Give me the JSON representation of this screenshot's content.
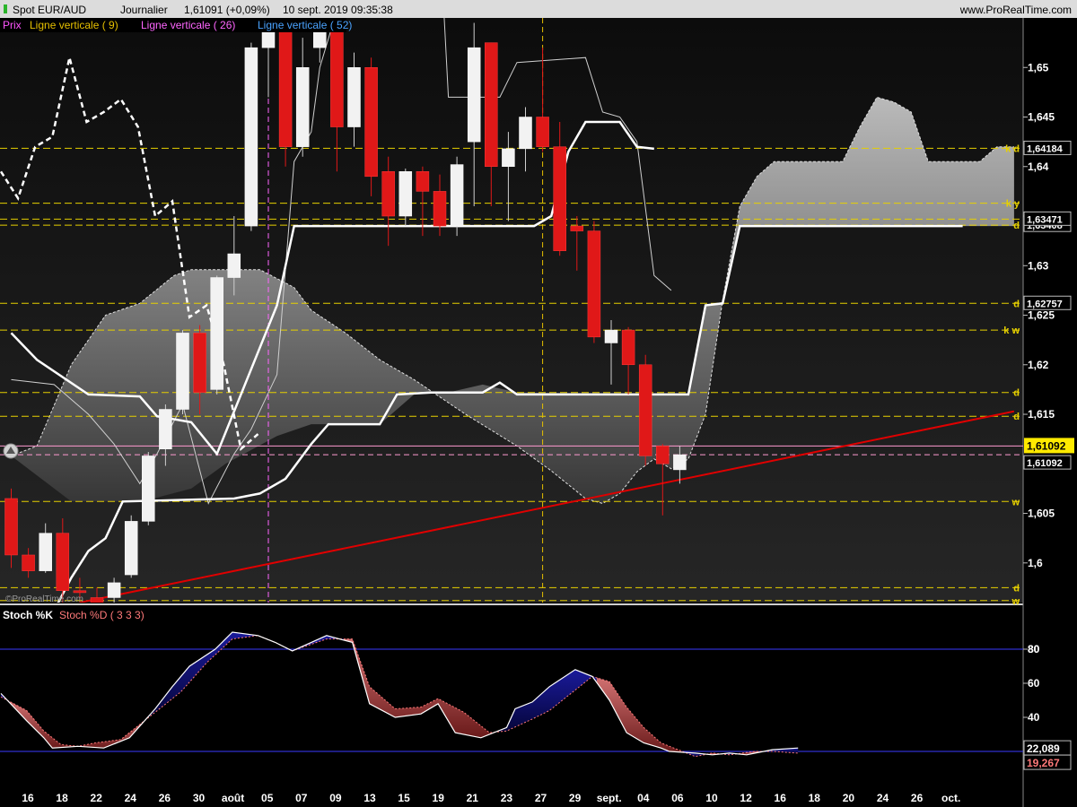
{
  "header": {
    "instrument": "Spot EUR/AUD",
    "period": "Journalier",
    "quote": "1,61091 (+0,09%)",
    "timestamp": "10 sept. 2019 09:35:38",
    "site": "www.ProRealTime.com"
  },
  "legend_main": [
    {
      "label": "Prix",
      "color": "#ff55ff"
    },
    {
      "label": "Ligne verticale ( 9)",
      "color": "#e6c000"
    },
    {
      "label": "Ligne verticale ( 26)",
      "color": "#ff66ff"
    },
    {
      "label": "Ligne verticale ( 52)",
      "color": "#4aa3ff"
    }
  ],
  "legend_stoch": [
    {
      "label": "Stoch %K",
      "color": "#ffffff"
    },
    {
      "label": "Stoch %D ( 3 3 3)",
      "color": "#ff7a7a"
    }
  ],
  "watermark": "©ProRealTime.com",
  "colors": {
    "bull": "#f2f2f2",
    "bear": "#e01818",
    "guide": "#e6d000",
    "trendline": "#e00000",
    "cloud": "#9a9a9a",
    "vline_pink": "#ff66ff",
    "vline_yellow": "#e6c000",
    "stoch_up_fill": "#0a0a6e",
    "stoch_down_fill": "#c06060"
  },
  "chart_data": [
    {
      "type": "candlestick",
      "title": "Spot EUR/AUD Journalier",
      "ylim": [
        1.596,
        1.655
      ],
      "y_ticks": [
        "1,6",
        "1,605",
        "1,61",
        "1,615",
        "1,62",
        "1,625",
        "1,63",
        "1,635",
        "1,64",
        "1,645",
        "1,65"
      ],
      "x_ticks": [
        "16",
        "18",
        "22",
        "24",
        "26",
        "30",
        "août",
        "05",
        "07",
        "09",
        "13",
        "15",
        "19",
        "21",
        "23",
        "27",
        "29",
        "sept.",
        "04",
        "06",
        "10",
        "12",
        "16",
        "18",
        "20",
        "24",
        "26",
        "oct."
      ],
      "candles": [
        {
          "o": 1.6065,
          "h": 1.6075,
          "l": 1.5995,
          "c": 1.6008
        },
        {
          "o": 1.6008,
          "h": 1.6015,
          "l": 1.5985,
          "c": 1.5992
        },
        {
          "o": 1.5992,
          "h": 1.604,
          "l": 1.599,
          "c": 1.603
        },
        {
          "o": 1.603,
          "h": 1.6045,
          "l": 1.596,
          "c": 1.5972
        },
        {
          "o": 1.5972,
          "h": 1.5985,
          "l": 1.596,
          "c": 1.597
        },
        {
          "o": 1.5965,
          "h": 1.5975,
          "l": 1.594,
          "c": 1.595
        },
        {
          "o": 1.5965,
          "h": 1.5985,
          "l": 1.595,
          "c": 1.598
        },
        {
          "o": 1.5988,
          "h": 1.6048,
          "l": 1.5985,
          "c": 1.6042
        },
        {
          "o": 1.6042,
          "h": 1.6112,
          "l": 1.6038,
          "c": 1.6108
        },
        {
          "o": 1.6115,
          "h": 1.616,
          "l": 1.6098,
          "c": 1.6155
        },
        {
          "o": 1.6155,
          "h": 1.6235,
          "l": 1.615,
          "c": 1.6232
        },
        {
          "o": 1.6232,
          "h": 1.624,
          "l": 1.615,
          "c": 1.6172
        },
        {
          "o": 1.6175,
          "h": 1.629,
          "l": 1.617,
          "c": 1.6288
        },
        {
          "o": 1.6288,
          "h": 1.635,
          "l": 1.627,
          "c": 1.6312
        },
        {
          "o": 1.634,
          "h": 1.6525,
          "l": 1.6335,
          "c": 1.652
        },
        {
          "o": 1.652,
          "h": 1.657,
          "l": 1.647,
          "c": 1.6555
        },
        {
          "o": 1.656,
          "h": 1.6605,
          "l": 1.64,
          "c": 1.642
        },
        {
          "o": 1.642,
          "h": 1.653,
          "l": 1.641,
          "c": 1.65
        },
        {
          "o": 1.652,
          "h": 1.657,
          "l": 1.6505,
          "c": 1.6555
        },
        {
          "o": 1.66,
          "h": 1.662,
          "l": 1.6395,
          "c": 1.644
        },
        {
          "o": 1.644,
          "h": 1.6515,
          "l": 1.642,
          "c": 1.65
        },
        {
          "o": 1.65,
          "h": 1.651,
          "l": 1.637,
          "c": 1.639
        },
        {
          "o": 1.6395,
          "h": 1.641,
          "l": 1.632,
          "c": 1.635
        },
        {
          "o": 1.635,
          "h": 1.6398,
          "l": 1.634,
          "c": 1.6395
        },
        {
          "o": 1.6395,
          "h": 1.64,
          "l": 1.633,
          "c": 1.6375
        },
        {
          "o": 1.6375,
          "h": 1.6392,
          "l": 1.633,
          "c": 1.634
        },
        {
          "o": 1.634,
          "h": 1.641,
          "l": 1.633,
          "c": 1.6402
        },
        {
          "o": 1.6425,
          "h": 1.6545,
          "l": 1.636,
          "c": 1.652
        },
        {
          "o": 1.6525,
          "h": 1.6525,
          "l": 1.636,
          "c": 1.64
        },
        {
          "o": 1.64,
          "h": 1.6435,
          "l": 1.6345,
          "c": 1.6418
        },
        {
          "o": 1.6418,
          "h": 1.646,
          "l": 1.6395,
          "c": 1.645
        },
        {
          "o": 1.645,
          "h": 1.652,
          "l": 1.6415,
          "c": 1.642
        },
        {
          "o": 1.642,
          "h": 1.6445,
          "l": 1.631,
          "c": 1.6315
        },
        {
          "o": 1.634,
          "h": 1.635,
          "l": 1.6295,
          "c": 1.6335
        },
        {
          "o": 1.6335,
          "h": 1.6345,
          "l": 1.6222,
          "c": 1.6228
        },
        {
          "o": 1.6222,
          "h": 1.6245,
          "l": 1.618,
          "c": 1.6235
        },
        {
          "o": 1.6235,
          "h": 1.6238,
          "l": 1.617,
          "c": 1.62
        },
        {
          "o": 1.62,
          "h": 1.621,
          "l": 1.6098,
          "c": 1.6108
        },
        {
          "o": 1.6118,
          "h": 1.612,
          "l": 1.6048,
          "c": 1.61
        },
        {
          "o": 1.6094,
          "h": 1.6118,
          "l": 1.608,
          "c": 1.61092
        }
      ],
      "tenkan_dotted": [
        1.6395,
        1.6368,
        1.642,
        1.643,
        1.651,
        1.6445,
        1.6455,
        1.6468,
        1.644,
        1.635,
        1.6365,
        1.6248,
        1.626,
        1.62,
        1.6115,
        1.613
      ],
      "kijun": [
        [
          0,
          1.6232
        ],
        [
          1.5,
          1.6205
        ],
        [
          4.5,
          1.617
        ],
        [
          7.5,
          1.6168
        ],
        [
          8.5,
          1.6148
        ],
        [
          10.5,
          1.6142
        ],
        [
          12,
          1.611
        ],
        [
          15.5,
          1.626
        ],
        [
          16.5,
          1.634
        ],
        [
          30.5,
          1.634
        ],
        [
          31.5,
          1.635
        ],
        [
          32.5,
          1.6415
        ],
        [
          33.5,
          1.6445
        ],
        [
          35.5,
          1.6445
        ],
        [
          36.5,
          1.642
        ],
        [
          37.5,
          1.6418
        ]
      ],
      "kijun_projection": [
        [
          0,
          1.5948
        ],
        [
          2.5,
          1.5952
        ],
        [
          3.5,
          1.5985
        ],
        [
          4.5,
          1.6012
        ],
        [
          5.5,
          1.6025
        ],
        [
          6.5,
          1.6062
        ],
        [
          13,
          1.6065
        ],
        [
          14.5,
          1.607
        ],
        [
          16,
          1.6085
        ],
        [
          17.5,
          1.612
        ],
        [
          18.5,
          1.614
        ],
        [
          21.5,
          1.614
        ],
        [
          22.5,
          1.617
        ],
        [
          24.5,
          1.6172
        ],
        [
          27.5,
          1.6172
        ],
        [
          28.5,
          1.6182
        ],
        [
          29.5,
          1.617
        ],
        [
          39.5,
          1.617
        ],
        [
          40.5,
          1.626
        ],
        [
          41.5,
          1.6262
        ],
        [
          42.5,
          1.634
        ],
        [
          55.5,
          1.634
        ]
      ],
      "chikou": [
        [
          0,
          1.6185
        ],
        [
          2.5,
          1.618
        ],
        [
          4.5,
          1.615
        ],
        [
          6,
          1.612
        ],
        [
          7.5,
          1.608
        ],
        [
          8.5,
          1.611
        ],
        [
          10,
          1.616
        ],
        [
          11.5,
          1.606
        ],
        [
          13,
          1.611
        ],
        [
          14,
          1.6135
        ],
        [
          15.5,
          1.619
        ],
        [
          16.5,
          1.6405
        ],
        [
          17.5,
          1.6435
        ],
        [
          18,
          1.65
        ],
        [
          19,
          1.6558
        ],
        [
          21,
          1.659
        ],
        [
          23,
          1.6645
        ],
        [
          25,
          1.6635
        ],
        [
          25.5,
          1.647
        ],
        [
          28.5,
          1.647
        ],
        [
          29.5,
          1.6505
        ],
        [
          33.5,
          1.651
        ],
        [
          34.5,
          1.6455
        ],
        [
          35.5,
          1.645
        ],
        [
          36.5,
          1.6425
        ],
        [
          37.5,
          1.629
        ],
        [
          38.5,
          1.6275
        ]
      ],
      "cloud_span_a": [
        [
          0,
          1.6108
        ],
        [
          1.5,
          1.6118
        ],
        [
          3.5,
          1.62
        ],
        [
          5.5,
          1.625
        ],
        [
          7.5,
          1.6262
        ],
        [
          9.5,
          1.629
        ],
        [
          10.5,
          1.6296
        ],
        [
          12.5,
          1.6296
        ],
        [
          14.5,
          1.6296
        ],
        [
          16.5,
          1.6278
        ],
        [
          17.5,
          1.6255
        ],
        [
          19.5,
          1.6232
        ],
        [
          21.5,
          1.6205
        ],
        [
          23.5,
          1.6185
        ],
        [
          26.5,
          1.615
        ],
        [
          29.5,
          1.6118
        ],
        [
          31.5,
          1.6093
        ],
        [
          33.5,
          1.6065
        ],
        [
          34.5,
          1.606
        ],
        [
          35.5,
          1.607
        ],
        [
          36.5,
          1.6092
        ],
        [
          37.5,
          1.6105
        ],
        [
          38.5,
          1.6095
        ],
        [
          39.5,
          1.6105
        ],
        [
          40.5,
          1.615
        ],
        [
          41.5,
          1.6265
        ],
        [
          42.5,
          1.636
        ],
        [
          43.5,
          1.639
        ],
        [
          44.5,
          1.6405
        ],
        [
          46.5,
          1.6405
        ],
        [
          48.5,
          1.6405
        ],
        [
          49.5,
          1.644
        ],
        [
          50.5,
          1.647
        ],
        [
          51.5,
          1.6465
        ],
        [
          52.5,
          1.6455
        ],
        [
          53.5,
          1.6405
        ],
        [
          55.5,
          1.6405
        ],
        [
          56.5,
          1.6405
        ],
        [
          57.5,
          1.642
        ],
        [
          58.5,
          1.642
        ]
      ],
      "cloud_span_b": [
        [
          0,
          1.6108
        ],
        [
          3.5,
          1.6062
        ],
        [
          6.5,
          1.6062
        ],
        [
          7.5,
          1.6062
        ],
        [
          8.5,
          1.6066
        ],
        [
          10.5,
          1.6075
        ],
        [
          12.5,
          1.61
        ],
        [
          15.5,
          1.6128
        ],
        [
          17.5,
          1.614
        ],
        [
          21.5,
          1.614
        ],
        [
          23.5,
          1.617
        ],
        [
          25.5,
          1.6172
        ],
        [
          27.5,
          1.618
        ],
        [
          29.5,
          1.6172
        ],
        [
          39.5,
          1.617
        ],
        [
          40.5,
          1.626
        ],
        [
          41.5,
          1.6262
        ],
        [
          42.5,
          1.634
        ],
        [
          58.5,
          1.634
        ]
      ],
      "trendline": [
        [
          4,
          1.596
        ],
        [
          58.5,
          1.6153
        ]
      ],
      "horizontal_levels": [
        {
          "y": 1.64184,
          "tag": "k d",
          "label": "1,64184"
        },
        {
          "y": 1.6363,
          "tag": "k y",
          "label": ""
        },
        {
          "y": 1.63408,
          "tag": "d",
          "label": "1,63408"
        },
        {
          "y": 1.6347,
          "tag": "",
          "label": "1,63471"
        },
        {
          "y": 1.6262,
          "tag": "d",
          "label": "1,62757"
        },
        {
          "y": 1.6235,
          "tag": "k w",
          "label": ""
        },
        {
          "y": 1.6172,
          "tag": "d",
          "label": ""
        },
        {
          "y": 1.6148,
          "tag": "d",
          "label": ""
        },
        {
          "y": 1.6062,
          "tag": "w",
          "label": ""
        },
        {
          "y": 1.5975,
          "tag": "d",
          "label": ""
        },
        {
          "y": 1.5962,
          "tag": "w",
          "label": ""
        }
      ],
      "current_price": {
        "y": 1.6118,
        "label": "1,61092"
      },
      "quote_line": {
        "y": 1.61092,
        "label": "1,61092"
      },
      "vertical_lines": [
        {
          "x": 15,
          "color": "pink"
        },
        {
          "x": 31,
          "color": "yellow"
        }
      ]
    },
    {
      "type": "line",
      "title": "Stoch %K / Stoch %D ( 3 3 3)",
      "ylim": [
        0,
        100
      ],
      "y_ticks": [
        "40",
        "60",
        "80"
      ],
      "levels": [
        80,
        20
      ],
      "k_label": "22,089",
      "d_label": "19,267",
      "k": [
        [
          0,
          54
        ],
        [
          1.5,
          38
        ],
        [
          2.5,
          28
        ],
        [
          3,
          22
        ],
        [
          4.5,
          23
        ],
        [
          6,
          22
        ],
        [
          7.5,
          28
        ],
        [
          9,
          45
        ],
        [
          10,
          58
        ],
        [
          11,
          70
        ],
        [
          12.5,
          80
        ],
        [
          13.5,
          90
        ],
        [
          15,
          88
        ],
        [
          16,
          84
        ],
        [
          17,
          79
        ],
        [
          19,
          88
        ],
        [
          20.5,
          84
        ],
        [
          21.5,
          48
        ],
        [
          23,
          40
        ],
        [
          24.5,
          42
        ],
        [
          25.5,
          48
        ],
        [
          26.5,
          31
        ],
        [
          28,
          28
        ],
        [
          29.5,
          34
        ],
        [
          30,
          45
        ],
        [
          31,
          49
        ],
        [
          32,
          58
        ],
        [
          33.5,
          68
        ],
        [
          34.5,
          64
        ],
        [
          35.5,
          50
        ],
        [
          36.5,
          31
        ],
        [
          37.5,
          25
        ],
        [
          38.5,
          22
        ],
        [
          39,
          20
        ],
        [
          40.5,
          19
        ],
        [
          41.5,
          18
        ],
        [
          42.5,
          19
        ],
        [
          43.5,
          18
        ],
        [
          44,
          19
        ],
        [
          45,
          21
        ],
        [
          46.5,
          22
        ]
      ],
      "d": [
        [
          0,
          52
        ],
        [
          1.5,
          44
        ],
        [
          2.5,
          32
        ],
        [
          3.5,
          24
        ],
        [
          4.5,
          23
        ],
        [
          5.5,
          25
        ],
        [
          7,
          27
        ],
        [
          8,
          35
        ],
        [
          9.5,
          47
        ],
        [
          10.5,
          55
        ],
        [
          12,
          72
        ],
        [
          13.5,
          86
        ],
        [
          15,
          88
        ],
        [
          16,
          84
        ],
        [
          17,
          79
        ],
        [
          19,
          86
        ],
        [
          20.5,
          86
        ],
        [
          21.5,
          58
        ],
        [
          23,
          45
        ],
        [
          24.5,
          46
        ],
        [
          25.5,
          51
        ],
        [
          27,
          43
        ],
        [
          28.5,
          31
        ],
        [
          29.5,
          32
        ],
        [
          31,
          39
        ],
        [
          32,
          44
        ],
        [
          33.5,
          56
        ],
        [
          34.5,
          64
        ],
        [
          35.5,
          61
        ],
        [
          36.5,
          46
        ],
        [
          37.5,
          34
        ],
        [
          38.5,
          25
        ],
        [
          39.5,
          21
        ],
        [
          40.5,
          17
        ],
        [
          41.5,
          19
        ],
        [
          42.5,
          18
        ],
        [
          44,
          20
        ],
        [
          45,
          20
        ],
        [
          46.5,
          19
        ]
      ]
    }
  ]
}
